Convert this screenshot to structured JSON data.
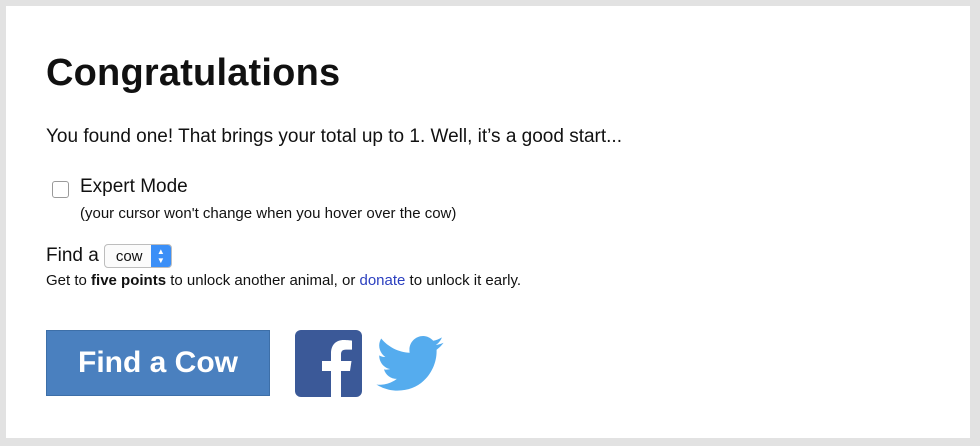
{
  "page": {
    "title": "Congratulations",
    "message": "You found one! That brings your total up to 1. Well, it’s a good start...",
    "expert_mode": {
      "label": "Expert Mode",
      "hint": "(your cursor won't change when you hover over the cow)",
      "checked": false
    },
    "find": {
      "prefix": "Find a",
      "selected_animal": "cow"
    },
    "unlock": {
      "text_start": "Get to ",
      "bold": "five points",
      "text_middle": " to unlock another animal, or ",
      "link": "donate",
      "text_end": " to unlock it early."
    },
    "find_button": "Find a Cow",
    "social": {
      "facebook_icon": "facebook-icon",
      "twitter_icon": "twitter-icon",
      "facebook_color": "#3b5998",
      "twitter_color": "#55acee"
    },
    "colors": {
      "button": "#4a80bf",
      "link": "#2b3fbf",
      "select_arrow": "#3b8ff7"
    }
  }
}
